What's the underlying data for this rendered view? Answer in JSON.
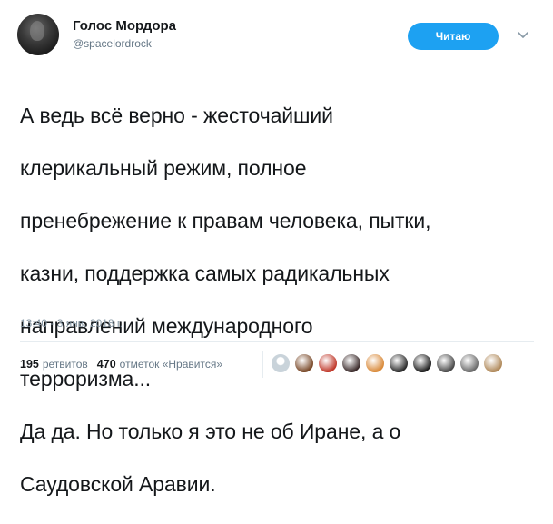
{
  "author": {
    "display_name": "Голос Мордора",
    "handle": "@spacelordrock"
  },
  "follow_button": {
    "label": "Читаю"
  },
  "tweet": {
    "lines": [
      "А ведь всё верно - жесточайший",
      "клерикальный режим, полное",
      "пренебрежение к правам человека, пытки,",
      "казни, поддержка самых радикальных",
      "направлений международного",
      "терроризма...",
      "Да да. Но только я это не об Иране, а о",
      "Саудовской Аравии."
    ],
    "timestamp": "13:40 - 3 янв. 2018 г."
  },
  "stats": {
    "retweets_count": "195",
    "retweets_label": "ретвитов",
    "likes_count": "470",
    "likes_label": "отметок «Нравится»"
  },
  "likers": [
    {
      "icon": "default-avatar",
      "color": "#c9d3da"
    },
    {
      "icon": "user-avatar",
      "color": "#7a4a2a"
    },
    {
      "icon": "user-avatar",
      "color": "#c0392b"
    },
    {
      "icon": "user-avatar",
      "color": "#3b2b2b"
    },
    {
      "icon": "user-avatar",
      "color": "#d98a3a"
    },
    {
      "icon": "user-avatar",
      "color": "#2c2c2c"
    },
    {
      "icon": "user-avatar",
      "color": "#1e1e1e"
    },
    {
      "icon": "user-avatar",
      "color": "#4a4a4a"
    },
    {
      "icon": "user-avatar",
      "color": "#6b6b6b"
    },
    {
      "icon": "user-avatar",
      "color": "#b0895a"
    }
  ],
  "colors": {
    "accent": "#1da1f2",
    "secondary_text": "#657786"
  }
}
